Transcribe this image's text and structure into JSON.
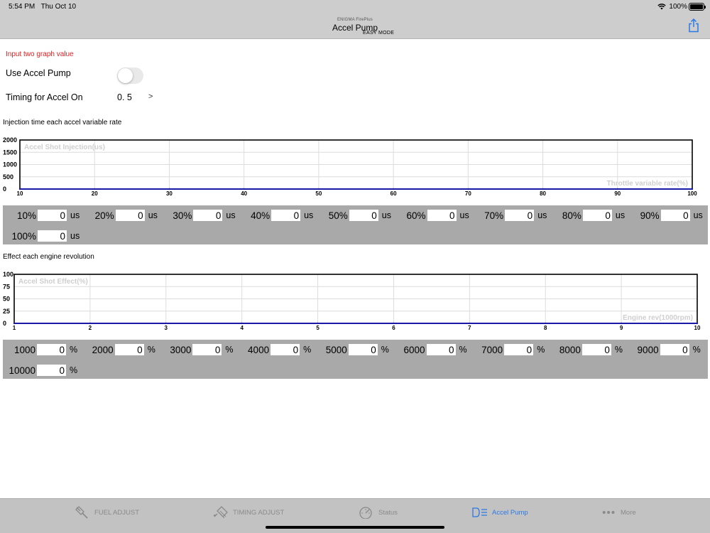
{
  "status_bar": {
    "time": "5:54 PM",
    "date": "Thu Oct 10",
    "battery": "100%"
  },
  "nav": {
    "subtitle": "ENIGMA FirePlus",
    "title": "Accel Pump",
    "mode": "EASY MODE"
  },
  "warning": "Input two graph value",
  "use_accel_pump": {
    "label": "Use Accel Pump",
    "enabled": false
  },
  "timing": {
    "label": "Timing for Accel On",
    "value": "0. 5",
    "chevron": ">"
  },
  "injection_section": {
    "title": "Injection time each accel variable rate",
    "unit": "us",
    "entries": [
      {
        "label": "10%",
        "value": "0"
      },
      {
        "label": "20%",
        "value": "0"
      },
      {
        "label": "30%",
        "value": "0"
      },
      {
        "label": "40%",
        "value": "0"
      },
      {
        "label": "50%",
        "value": "0"
      },
      {
        "label": "60%",
        "value": "0"
      },
      {
        "label": "70%",
        "value": "0"
      },
      {
        "label": "80%",
        "value": "0"
      },
      {
        "label": "90%",
        "value": "0"
      },
      {
        "label": "100%",
        "value": "0"
      }
    ]
  },
  "effect_section": {
    "title": "Effect each engine revolution",
    "unit": "%",
    "entries": [
      {
        "label": "1000",
        "value": "0"
      },
      {
        "label": "2000",
        "value": "0"
      },
      {
        "label": "3000",
        "value": "0"
      },
      {
        "label": "4000",
        "value": "0"
      },
      {
        "label": "5000",
        "value": "0"
      },
      {
        "label": "6000",
        "value": "0"
      },
      {
        "label": "7000",
        "value": "0"
      },
      {
        "label": "8000",
        "value": "0"
      },
      {
        "label": "9000",
        "value": "0"
      },
      {
        "label": "10000",
        "value": "0"
      }
    ]
  },
  "chart_data": [
    {
      "type": "line",
      "title": "Accel Shot Injection(us)",
      "xlabel": "Throttle variable rate(%)",
      "ylabel": "",
      "x": [
        10,
        20,
        30,
        40,
        50,
        60,
        70,
        80,
        90,
        100
      ],
      "series": [
        {
          "values": [
            0,
            0,
            0,
            0,
            0,
            0,
            0,
            0,
            0,
            0
          ]
        }
      ],
      "xlim": [
        10,
        100
      ],
      "ylim": [
        0,
        2000
      ],
      "yticks": [
        0,
        500,
        1000,
        1500,
        2000
      ],
      "grid": true,
      "line_color": "#1a1aa6"
    },
    {
      "type": "line",
      "title": "Accel Shot Effect(%)",
      "xlabel": "Engine rev(1000rpm)",
      "ylabel": "",
      "x": [
        1,
        2,
        3,
        4,
        5,
        6,
        7,
        8,
        9,
        10
      ],
      "series": [
        {
          "values": [
            0,
            0,
            0,
            0,
            0,
            0,
            0,
            0,
            0,
            0
          ]
        }
      ],
      "xlim": [
        1,
        10
      ],
      "ylim": [
        0,
        100
      ],
      "yticks": [
        0,
        25,
        50,
        75,
        100
      ],
      "grid": true,
      "line_color": "#1a1aa6"
    }
  ],
  "tabs": [
    {
      "label": "FUEL ADJUST",
      "icon": "fuel-injector-icon",
      "active": false
    },
    {
      "label": "TIMING ADJUST",
      "icon": "spark-plug-icon",
      "active": false
    },
    {
      "label": "Status",
      "icon": "gauge-icon",
      "active": false
    },
    {
      "label": "Accel Pump",
      "icon": "accel-pump-icon",
      "active": true
    },
    {
      "label": "More",
      "icon": "more-dots-icon",
      "active": false
    }
  ],
  "colors": {
    "active_tab": "#2a79e6",
    "warning": "#e02020",
    "grid_bg": "#a9a9a9"
  }
}
